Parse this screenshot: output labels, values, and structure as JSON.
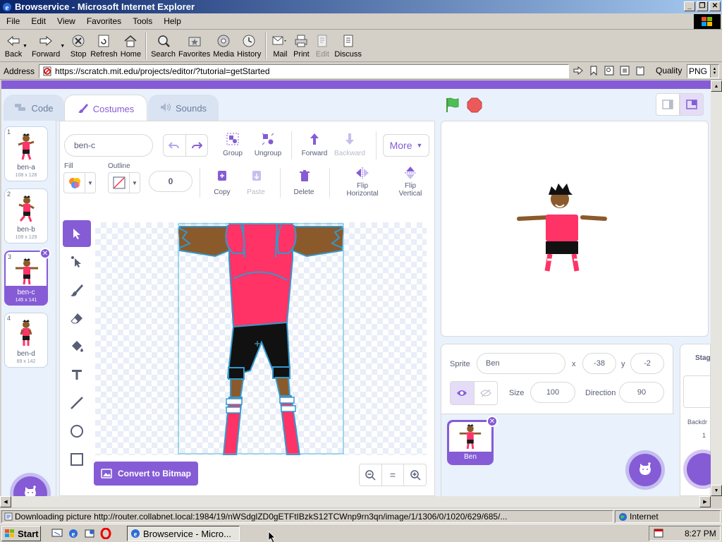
{
  "window": {
    "title": "Browservice - Microsoft Internet Explorer"
  },
  "menu": [
    "File",
    "Edit",
    "View",
    "Favorites",
    "Tools",
    "Help"
  ],
  "toolbar": {
    "back": "Back",
    "forward": "Forward",
    "stop": "Stop",
    "refresh": "Refresh",
    "home": "Home",
    "search": "Search",
    "favorites": "Favorites",
    "media": "Media",
    "history": "History",
    "mail": "Mail",
    "print": "Print",
    "edit": "Edit",
    "discuss": "Discuss"
  },
  "address": {
    "label": "Address",
    "url": "https://scratch.mit.edu/projects/editor/?tutorial=getStarted",
    "quality_label": "Quality",
    "quality_value": "PNG"
  },
  "scratch": {
    "tabs": {
      "code": "Code",
      "costumes": "Costumes",
      "sounds": "Sounds"
    },
    "costumes": [
      {
        "num": "1",
        "name": "ben-a",
        "size": "108 x 128"
      },
      {
        "num": "2",
        "name": "ben-b",
        "size": "109 x 129"
      },
      {
        "num": "3",
        "name": "ben-c",
        "size": "145 x 141"
      },
      {
        "num": "4",
        "name": "ben-d",
        "size": "89 x 142"
      }
    ],
    "editor": {
      "costume_name": "ben-c",
      "group": "Group",
      "ungroup": "Ungroup",
      "forward": "Forward",
      "backward": "Backward",
      "more": "More",
      "fill": "Fill",
      "outline": "Outline",
      "outline_width": "0",
      "copy": "Copy",
      "paste": "Paste",
      "delete": "Delete",
      "flip_h_1": "Flip",
      "flip_h_2": "Horizontal",
      "flip_v_1": "Flip",
      "flip_v_2": "Vertical",
      "convert": "Convert to Bitmap",
      "zoom_out": "−",
      "zoom_reset": "=",
      "zoom_in": "+"
    },
    "sprite": {
      "label": "Sprite",
      "name": "Ben",
      "x_label": "x",
      "x": "-38",
      "y_label": "y",
      "y": "-2",
      "size_label": "Size",
      "size": "100",
      "direction_label": "Direction",
      "direction": "90",
      "tile_name": "Ben"
    },
    "stage_panel": {
      "title": "Stag",
      "backdrops_label": "Backdr",
      "backdrops_count": "1"
    }
  },
  "status": {
    "text": "Downloading picture http://router.collabnet.local:1984/19/nWSdglZD0gETFtIBzkS12TCWnp9rn3qn/image/1/1306/0/1020/629/685/...",
    "zone": "Internet"
  },
  "taskbar": {
    "start": "Start",
    "task": "Browservice - Micro...",
    "clock": "8:27 PM"
  },
  "colors": {
    "scratch_purple": "#855cd6",
    "sprite_shirt": "#ff3366",
    "sprite_skin": "#8b5a2b"
  }
}
